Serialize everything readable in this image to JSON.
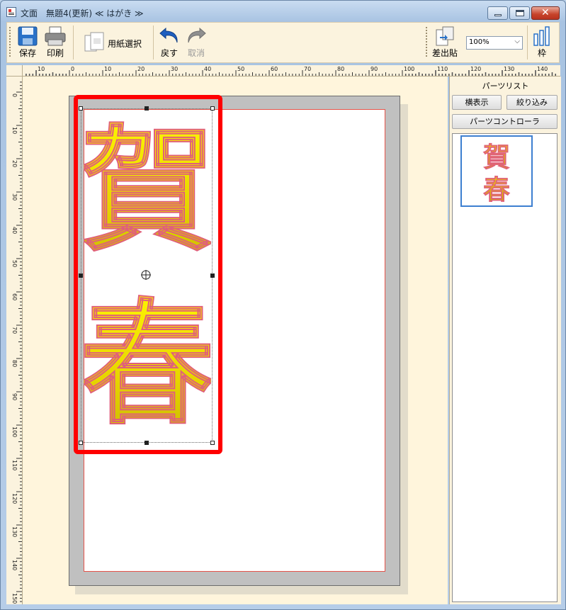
{
  "window": {
    "title": "文面　無題4(更新) ≪ はがき ≫",
    "controls": {
      "minimize_icon": "minimize-icon",
      "maximize_icon": "maximize-icon",
      "close_icon": "close-icon"
    }
  },
  "toolbar": {
    "save_label": "保存",
    "print_label": "印刷",
    "paper_select_label": "用紙選択",
    "undo_label": "戻す",
    "redo_label": "取消",
    "merge_label": "差出貼",
    "zoom_value": "100%",
    "frame_label": "枠"
  },
  "rulers": {
    "top_ticks": [
      "10",
      "0",
      "10",
      "20",
      "30",
      "40",
      "50",
      "60",
      "70",
      "80",
      "90",
      "100",
      "110",
      "120",
      "130",
      "140"
    ],
    "left_ticks": [
      "0",
      "10",
      "20",
      "30",
      "40",
      "50",
      "60",
      "70",
      "80",
      "90",
      "100",
      "110",
      "120",
      "130",
      "140",
      "150"
    ]
  },
  "canvas": {
    "text_top": "賀",
    "text_bottom": "春",
    "colors": {
      "fill_top": "#fff700",
      "fill_bottom": "#c9b800",
      "outline": "#e0607a",
      "selection_frame": "#ff0000"
    }
  },
  "panel": {
    "title": "パーツリスト",
    "horizontal_button": "横表示",
    "filter_button": "絞り込み",
    "controller_button": "パーツコントローラ",
    "thumb_text_top": "賀",
    "thumb_text_bottom": "春"
  }
}
